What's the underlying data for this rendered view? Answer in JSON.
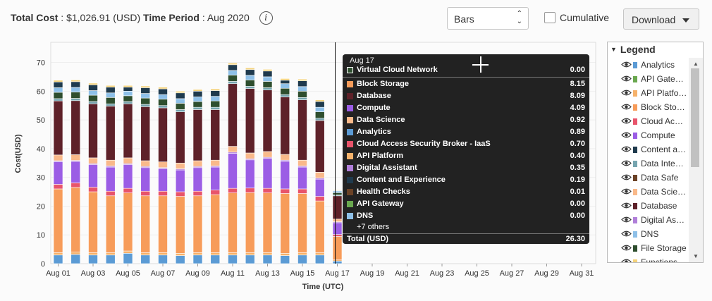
{
  "header": {
    "total_cost_label": "Total Cost",
    "total_cost_value": ": $1,026.91 (USD)",
    "time_period_label": "Time Period",
    "time_period_value": ": Aug 2020",
    "info_icon": "info-icon"
  },
  "controls": {
    "chart_type_select": "Bars",
    "cumulative_label": "Cumulative",
    "cumulative_checked": false,
    "download_label": "Download"
  },
  "legend": {
    "title": "Legend",
    "items": [
      {
        "name": "Analytics",
        "color": "#5b9bd5"
      },
      {
        "name": "API Gate…",
        "color": "#6aa84f"
      },
      {
        "name": "API Platfo…",
        "color": "#f6b26b"
      },
      {
        "name": "Block Sto…",
        "color": "#f79c5a"
      },
      {
        "name": "Cloud Ac…",
        "color": "#e8546b"
      },
      {
        "name": "Compute",
        "color": "#9b5de5"
      },
      {
        "name": "Content a…",
        "color": "#1f3a4d"
      },
      {
        "name": "Data Inte…",
        "color": "#76a5af"
      },
      {
        "name": "Data Safe",
        "color": "#6b4226"
      },
      {
        "name": "Data Scie…",
        "color": "#f9b98a"
      },
      {
        "name": "Database",
        "color": "#5e2129"
      },
      {
        "name": "Digital As…",
        "color": "#b07fd9"
      },
      {
        "name": "DNS",
        "color": "#8ec0e8"
      },
      {
        "name": "File Storage",
        "color": "#2e4e2e"
      },
      {
        "name": "Functions",
        "color": "#f4d27a"
      }
    ]
  },
  "tooltip": {
    "date": "Aug 17",
    "highlight": {
      "name": "Virtual Cloud Network",
      "value": "0.00",
      "color": "#2e4e2e"
    },
    "rows": [
      {
        "name": "Block Storage",
        "value": "8.15",
        "color": "#f79c5a"
      },
      {
        "name": "Database",
        "value": "8.09",
        "color": "#5e2129"
      },
      {
        "name": "Compute",
        "value": "4.09",
        "color": "#9b5de5"
      },
      {
        "name": "Data Science",
        "value": "0.92",
        "color": "#f9b98a"
      },
      {
        "name": "Analytics",
        "value": "0.89",
        "color": "#5b9bd5"
      },
      {
        "name": "Cloud Access Security Broker - IaaS",
        "value": "0.70",
        "color": "#e8546b"
      },
      {
        "name": "API Platform",
        "value": "0.40",
        "color": "#f6b26b"
      },
      {
        "name": "Digital Assistant",
        "value": "0.35",
        "color": "#b07fd9"
      },
      {
        "name": "Content and Experience",
        "value": "0.19",
        "color": "#1f3a4d"
      },
      {
        "name": "Health Checks",
        "value": "0.01",
        "color": "#6b4226"
      },
      {
        "name": "API Gateway",
        "value": "0.00",
        "color": "#6aa84f"
      },
      {
        "name": "DNS",
        "value": "0.00",
        "color": "#8ec0e8"
      }
    ],
    "others": "+7 others",
    "total_label": "Total (USD)",
    "total_value": "26.30"
  },
  "chart_data": {
    "type": "bar",
    "stacked": true,
    "xlabel": "Time (UTC)",
    "ylabel": "Cost(USD)",
    "ylim": [
      0,
      77
    ],
    "yticks": [
      0,
      10,
      20,
      30,
      40,
      50,
      60,
      70
    ],
    "x_tick_labels": [
      "Aug 01",
      "Aug 03",
      "Aug 05",
      "Aug 07",
      "Aug 09",
      "Aug 11",
      "Aug 13",
      "Aug 15",
      "Aug 17",
      "Aug 19",
      "Aug 21",
      "Aug 23",
      "Aug 25",
      "Aug 27",
      "Aug 29",
      "Aug 31"
    ],
    "categories": [
      "Aug 01",
      "Aug 02",
      "Aug 03",
      "Aug 04",
      "Aug 05",
      "Aug 06",
      "Aug 07",
      "Aug 08",
      "Aug 09",
      "Aug 10",
      "Aug 11",
      "Aug 12",
      "Aug 13",
      "Aug 14",
      "Aug 15",
      "Aug 16",
      "Aug 17"
    ],
    "series": [
      {
        "name": "Analytics",
        "color": "#5b9bd5",
        "values": [
          3.0,
          3.2,
          3.0,
          3.0,
          3.6,
          3.0,
          3.0,
          2.8,
          3.0,
          3.0,
          3.0,
          3.0,
          3.0,
          2.8,
          3.0,
          3.0,
          0.89
        ]
      },
      {
        "name": "API Platform",
        "color": "#f6b26b",
        "values": [
          0.8,
          0.8,
          0.8,
          0.8,
          0.8,
          0.8,
          0.8,
          0.8,
          0.8,
          0.8,
          0.8,
          0.8,
          0.8,
          0.8,
          0.8,
          0.8,
          0.4
        ]
      },
      {
        "name": "Block Storage",
        "color": "#f79c5a",
        "values": [
          22.2,
          22.5,
          21.2,
          19.8,
          20.2,
          19.8,
          19.8,
          19.8,
          19.8,
          20.2,
          20.8,
          20.9,
          20.8,
          20.8,
          20.6,
          18.0,
          8.15
        ]
      },
      {
        "name": "Cloud Access Security Broker - IaaS",
        "color": "#e8546b",
        "values": [
          1.6,
          1.6,
          1.6,
          1.6,
          1.6,
          1.6,
          1.6,
          1.6,
          1.6,
          1.6,
          1.6,
          1.6,
          1.6,
          1.6,
          1.6,
          1.6,
          0.7
        ]
      },
      {
        "name": "Compute",
        "color": "#9b5de5",
        "values": [
          7.8,
          7.4,
          7.8,
          8.4,
          8.2,
          8.2,
          7.8,
          7.6,
          8.2,
          8.0,
          12.2,
          9.8,
          10.4,
          9.6,
          7.6,
          6.0,
          4.09
        ]
      },
      {
        "name": "Digital Assistant",
        "color": "#b07fd9",
        "values": [
          0.4,
          0.4,
          0.4,
          0.4,
          0.4,
          0.4,
          0.4,
          0.4,
          0.4,
          0.4,
          0.4,
          0.4,
          0.4,
          0.4,
          0.4,
          0.4,
          0.35
        ]
      },
      {
        "name": "Data Science",
        "color": "#f9b98a",
        "values": [
          2.0,
          2.0,
          2.0,
          2.0,
          2.0,
          2.0,
          2.0,
          2.0,
          2.0,
          2.0,
          2.0,
          2.0,
          2.0,
          2.0,
          2.0,
          2.0,
          0.92
        ]
      },
      {
        "name": "Database",
        "color": "#5e2129",
        "values": [
          18.8,
          18.8,
          18.8,
          18.8,
          18.8,
          18.8,
          18.8,
          17.8,
          17.8,
          17.6,
          21.8,
          22.4,
          21.4,
          20.0,
          21.0,
          18.0,
          8.09
        ]
      },
      {
        "name": "Data Integration",
        "color": "#76a5af",
        "values": [
          0.8,
          0.8,
          0.8,
          0.8,
          0.8,
          0.8,
          0.8,
          0.8,
          0.8,
          0.8,
          0.8,
          0.8,
          0.8,
          0.8,
          0.8,
          0.8,
          0.3
        ]
      },
      {
        "name": "File Storage",
        "color": "#2e4e2e",
        "values": [
          2.2,
          2.2,
          2.2,
          2.2,
          2.0,
          2.2,
          2.2,
          2.2,
          2.0,
          2.2,
          2.2,
          2.2,
          2.2,
          2.2,
          2.2,
          2.2,
          0.8
        ]
      },
      {
        "name": "DNS",
        "color": "#8ec0e8",
        "values": [
          1.6,
          1.6,
          1.6,
          1.6,
          1.6,
          1.6,
          1.6,
          1.6,
          1.6,
          1.6,
          1.6,
          1.6,
          1.6,
          1.6,
          1.6,
          1.6,
          0.6
        ]
      },
      {
        "name": "Content and Experience",
        "color": "#1f3a4d",
        "values": [
          2.0,
          2.0,
          2.0,
          2.0,
          1.4,
          2.0,
          2.0,
          2.0,
          2.0,
          2.0,
          2.0,
          2.0,
          2.0,
          1.2,
          2.0,
          2.0,
          0.19
        ]
      },
      {
        "name": "Functions",
        "color": "#f4d27a",
        "values": [
          0.6,
          0.6,
          0.6,
          0.6,
          0.6,
          0.6,
          0.6,
          0.6,
          0.6,
          0.6,
          0.6,
          0.6,
          0.6,
          0.6,
          0.6,
          0.6,
          0.2
        ]
      }
    ]
  }
}
